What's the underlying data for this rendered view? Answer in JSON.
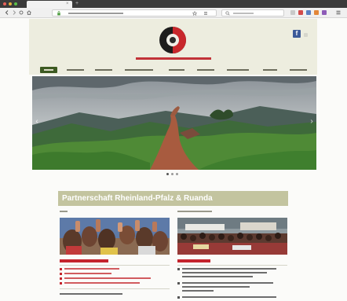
{
  "browser": {
    "tab": {
      "title": ""
    },
    "address": {
      "url": ""
    },
    "search": {
      "placeholder": ""
    },
    "icons": [
      "back-icon",
      "forward-icon",
      "reload-icon",
      "home-icon",
      "lock-icon",
      "bookmark-icon",
      "download-icon",
      "menu-icon",
      "search-icon",
      "close-icon",
      "new-tab-icon"
    ]
  },
  "header": {
    "logo": "partnership-seal-logo",
    "tagline": "",
    "social": {
      "facebook": "f"
    }
  },
  "nav": {
    "items": [
      "",
      "",
      "",
      "",
      "",
      "",
      "",
      "",
      ""
    ],
    "active_index": 0
  },
  "hero": {
    "image": "rwandan-hillside-path-landscape",
    "slides": 3,
    "current_slide": 0
  },
  "main": {
    "banner": "Partnerschaft Rheinland-Pfalz & Ruanda",
    "left": {
      "label": "",
      "image": "children-raising-hands-photo",
      "section_title": "",
      "links": [
        "",
        "",
        "",
        "",
        ""
      ]
    },
    "right": {
      "label": "",
      "image": "crowd-gathering-photo",
      "section_title": "",
      "items": [
        "",
        "",
        "",
        ""
      ]
    }
  },
  "colors": {
    "brand_red": "#c4242d",
    "nav_active": "#3d5a22",
    "header_bg": "#ededdf",
    "banner_bg": "#c3c49f",
    "facebook": "#3b5998"
  }
}
